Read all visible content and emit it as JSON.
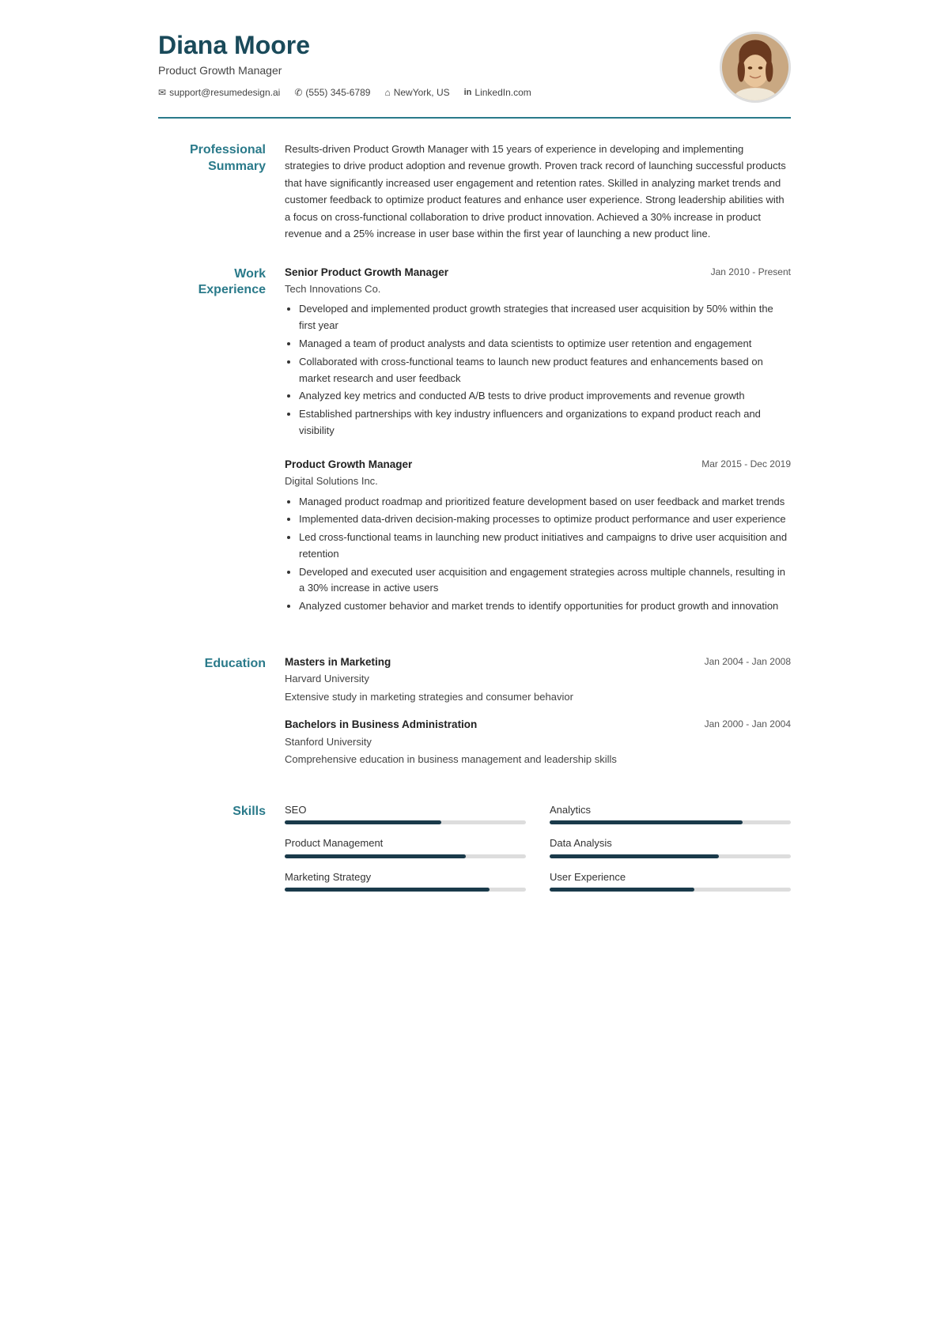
{
  "header": {
    "name": "Diana Moore",
    "title": "Product Growth Manager",
    "contacts": [
      {
        "icon": "email",
        "text": "support@resumedesign.ai"
      },
      {
        "icon": "phone",
        "text": "(555) 345-6789"
      },
      {
        "icon": "location",
        "text": "NewYork, US"
      },
      {
        "icon": "linkedin",
        "text": "LinkedIn.com"
      }
    ]
  },
  "sections": {
    "summary": {
      "label": "Professional\nSummary",
      "text": "Results-driven Product Growth Manager with 15 years of experience in developing and implementing strategies to drive product adoption and revenue growth. Proven track record of launching successful products that have significantly increased user engagement and retention rates. Skilled in analyzing market trends and customer feedback to optimize product features and enhance user experience. Strong leadership abilities with a focus on cross-functional collaboration to drive product innovation. Achieved a 30% increase in product revenue and a 25% increase in user base within the first year of launching a new product line."
    },
    "work": {
      "label": "Work\nExperience",
      "jobs": [
        {
          "title": "Senior Product Growth Manager",
          "date": "Jan 2010 - Present",
          "company": "Tech Innovations Co.",
          "bullets": [
            "Developed and implemented product growth strategies that increased user acquisition by 50% within the first year",
            "Managed a team of product analysts and data scientists to optimize user retention and engagement",
            "Collaborated with cross-functional teams to launch new product features and enhancements based on market research and user feedback",
            "Analyzed key metrics and conducted A/B tests to drive product improvements and revenue growth",
            "Established partnerships with key industry influencers and organizations to expand product reach and visibility"
          ]
        },
        {
          "title": "Product Growth Manager",
          "date": "Mar 2015 - Dec 2019",
          "company": "Digital Solutions Inc.",
          "bullets": [
            "Managed product roadmap and prioritized feature development based on user feedback and market trends",
            "Implemented data-driven decision-making processes to optimize product performance and user experience",
            "Led cross-functional teams in launching new product initiatives and campaigns to drive user acquisition and retention",
            "Developed and executed user acquisition and engagement strategies across multiple channels, resulting in a 30% increase in active users",
            "Analyzed customer behavior and market trends to identify opportunities for product growth and innovation"
          ]
        }
      ]
    },
    "education": {
      "label": "Education",
      "items": [
        {
          "degree": "Masters in Marketing",
          "date": "Jan 2004 - Jan 2008",
          "school": "Harvard University",
          "desc": "Extensive study in marketing strategies and consumer behavior"
        },
        {
          "degree": "Bachelors in Business Administration",
          "date": "Jan 2000 - Jan 2004",
          "school": "Stanford University",
          "desc": "Comprehensive education in business management and leadership skills"
        }
      ]
    },
    "skills": {
      "label": "Skills",
      "items": [
        {
          "name": "SEO",
          "pct": 65
        },
        {
          "name": "Analytics",
          "pct": 80
        },
        {
          "name": "Product Management",
          "pct": 75
        },
        {
          "name": "Data Analysis",
          "pct": 70
        },
        {
          "name": "Marketing Strategy",
          "pct": 85
        },
        {
          "name": "User Experience",
          "pct": 60
        }
      ]
    }
  }
}
